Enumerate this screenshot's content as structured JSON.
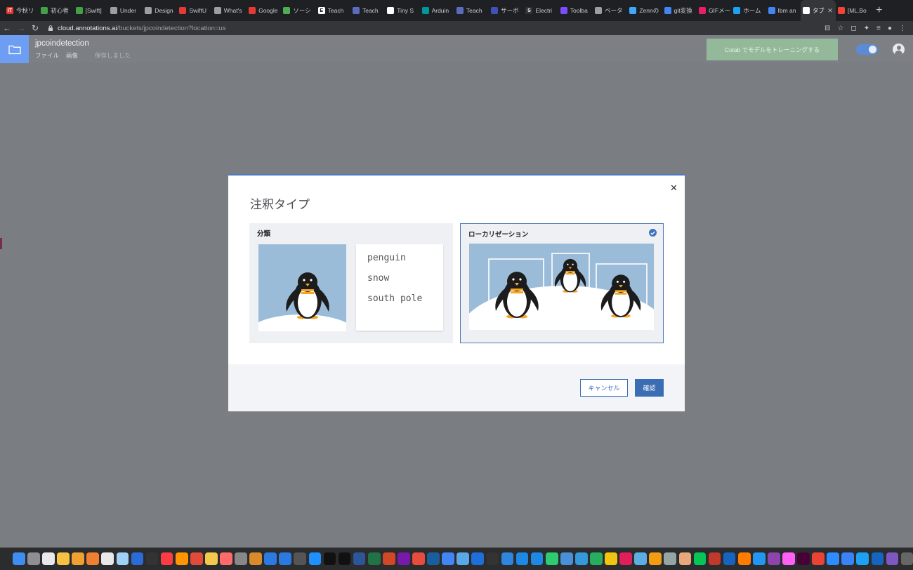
{
  "browser": {
    "tabs": [
      {
        "title": "今秋リ",
        "color": "#e53935",
        "glyph": "IT"
      },
      {
        "title": "初心者",
        "color": "#43a047",
        "glyph": ""
      },
      {
        "title": "[Swift]",
        "color": "#43a047",
        "glyph": ""
      },
      {
        "title": "Under",
        "color": "#9e9e9e",
        "glyph": ""
      },
      {
        "title": "Design",
        "color": "#9e9e9e",
        "glyph": ""
      },
      {
        "title": "SwiftU",
        "color": "#e53935",
        "glyph": ""
      },
      {
        "title": "What's",
        "color": "#9e9e9e",
        "glyph": ""
      },
      {
        "title": "Google",
        "color": "#e53935",
        "glyph": ""
      },
      {
        "title": "ソーシ",
        "color": "#4caf50",
        "glyph": ""
      },
      {
        "title": "Teach",
        "color": "#fff",
        "glyph": "E"
      },
      {
        "title": "Teach",
        "color": "#5c6bc0",
        "glyph": ""
      },
      {
        "title": "Tiny S",
        "color": "#fff",
        "glyph": ""
      },
      {
        "title": "Arduin",
        "color": "#00979c",
        "glyph": ""
      },
      {
        "title": "Teach",
        "color": "#5c6bc0",
        "glyph": ""
      },
      {
        "title": "サーボ",
        "color": "#3f51b5",
        "glyph": ""
      },
      {
        "title": "Electri",
        "color": "#333",
        "glyph": "S"
      },
      {
        "title": "Toolba",
        "color": "#7c4dff",
        "glyph": ""
      },
      {
        "title": "ベータ",
        "color": "#9e9e9e",
        "glyph": ""
      },
      {
        "title": "Zennの",
        "color": "#3ea8ff",
        "glyph": ""
      },
      {
        "title": "git変換",
        "color": "#4285f4",
        "glyph": ""
      },
      {
        "title": "GIFメー",
        "color": "#e91e63",
        "glyph": ""
      },
      {
        "title": "ホーム",
        "color": "#1da1f2",
        "glyph": ""
      },
      {
        "title": "Ibm an",
        "color": "#4285f4",
        "glyph": ""
      },
      {
        "title": "タブ",
        "color": "#fff",
        "glyph": "",
        "active": true
      },
      {
        "title": "[ML.Bo",
        "color": "#f44336",
        "glyph": ""
      }
    ],
    "url_host": "cloud.annotations.ai",
    "url_path": "/buckets/jpcoindetection?location=us"
  },
  "header": {
    "project_name": "jpcoindetection",
    "menu_file": "ファイル",
    "menu_image": "画像",
    "save_status": "保存しました",
    "colab_button": "Colab でモデルをトレーニングする"
  },
  "modal": {
    "title": "注釈タイプ",
    "option_classification": {
      "label": "分類",
      "tags": [
        "penguin",
        "snow",
        "south pole"
      ]
    },
    "option_localization": {
      "label": "ローカリゼーション",
      "selected": true
    },
    "cancel_label": "キャンセル",
    "confirm_label": "確認"
  },
  "colors": {
    "accent": "#3b6db4",
    "colab_green": "#93b99a",
    "folder_blue": "#6e9ef3",
    "sky": "#9bbcd9"
  }
}
